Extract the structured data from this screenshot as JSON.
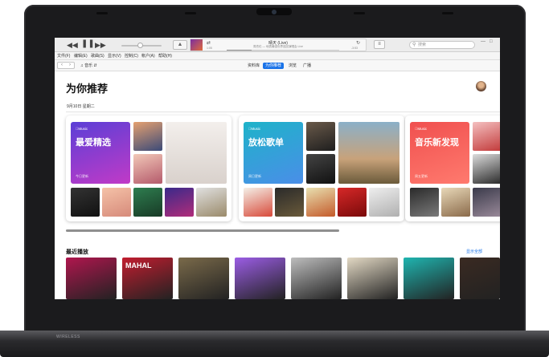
{
  "device": {
    "base_label": "WIRELESS"
  },
  "toolbar": {
    "prev_icon": "rewind-icon",
    "play_icon": "pause-icon",
    "next_icon": "fast-forward-icon",
    "airplay_icon": "airplay-icon",
    "list_icon": "up-next-list-icon",
    "volume_level": 0.45
  },
  "now_playing": {
    "title": "晴天 (Live)",
    "subtitle": "周杰伦 — 地表最强世界巡回演唱会 Live",
    "elapsed": "1:05",
    "remaining": "-3:53",
    "progress": 0.22
  },
  "search": {
    "placeholder": "搜索"
  },
  "menu": {
    "items": [
      "文件(F)",
      "编辑(E)",
      "歌曲(S)",
      "显示(V)",
      "控制(C)",
      "帐户(A)",
      "帮助(H)"
    ]
  },
  "nav": {
    "media_type": "音乐",
    "tabs": [
      {
        "label": "资料库",
        "active": false
      },
      {
        "label": "为你推荐",
        "active": true
      },
      {
        "label": "浏览",
        "active": false
      },
      {
        "label": "广播",
        "active": false
      }
    ]
  },
  "page": {
    "title": "为你推荐",
    "date": "9月10日 星期二"
  },
  "playlists": [
    {
      "brand": "Music",
      "title": "最爱精选",
      "update": "今日更新",
      "color_top": "#5b3fd6",
      "color_bottom": "#c13ac7"
    },
    {
      "brand": "Music",
      "title": "放松歌单",
      "update": "周日更新",
      "color_top": "#1eb3c9",
      "color_bottom": "#4a8ee8"
    },
    {
      "brand": "Music",
      "title": "音乐新发现",
      "update": "周五更新",
      "color_top": "#f0504f",
      "color_bottom": "#ff7a6e"
    }
  ],
  "recent": {
    "title": "最近播放",
    "see_all": "显示全部",
    "albums": [
      {
        "text": "",
        "color": "#b0164e"
      },
      {
        "text": "MAHAL",
        "color": "#c21d2f"
      },
      {
        "text": "",
        "color": "#7a6a4a"
      },
      {
        "text": "",
        "color": "#9b5de5"
      },
      {
        "text": "",
        "color": "#bdbdbd"
      },
      {
        "text": "",
        "color": "#e3d9c4"
      },
      {
        "text": "",
        "color": "#1fb5b0"
      },
      {
        "text": "",
        "color": "#3a2a22"
      }
    ]
  }
}
